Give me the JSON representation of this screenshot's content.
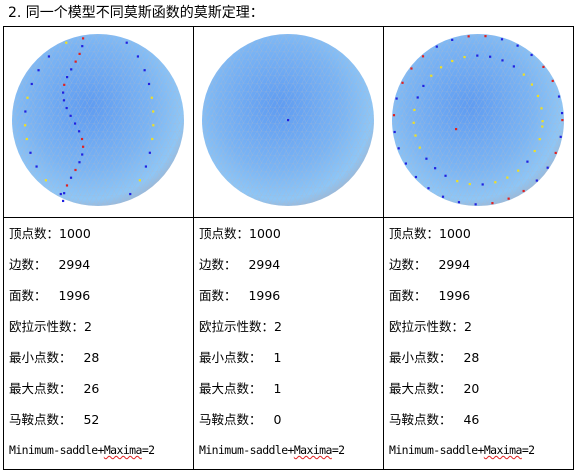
{
  "heading": "2. 同一个模型不同莫斯函数的莫斯定理：",
  "colors": {
    "sphere": "#6aa8f0",
    "min_point": "#2020e0",
    "max_point": "#e02020",
    "saddle_point": "#f0e020"
  },
  "columns": [
    {
      "vertices_label": "顶点数：",
      "vertices": "1000",
      "edges_label": "边数：",
      "edges": "2994",
      "faces_label": "面数：",
      "faces": "1996",
      "euler_label": "欧拉示性数：",
      "euler": "2",
      "min_label": "最小点数：",
      "min": "28",
      "max_label": "最大点数：",
      "max": "26",
      "saddle_label": "马鞍点数：",
      "saddle": "52",
      "formula_a": "Minimum-saddle+",
      "formula_b": "Maxima",
      "formula_c": "=2"
    },
    {
      "vertices_label": "顶点数：",
      "vertices": "1000",
      "edges_label": "边数：",
      "edges": "2994",
      "faces_label": "面数：",
      "faces": "1996",
      "euler_label": "欧拉示性数：",
      "euler": "2",
      "min_label": "最小点数：",
      "min": "1",
      "max_label": "最大点数：",
      "max": "1",
      "saddle_label": "马鞍点数：",
      "saddle": "0",
      "formula_a": "Minimum-saddle+",
      "formula_b": "Maxima",
      "formula_c": "=2"
    },
    {
      "vertices_label": "顶点数：",
      "vertices": "1000",
      "edges_label": "边数：",
      "edges": "2994",
      "faces_label": "面数：",
      "faces": "1996",
      "euler_label": "欧拉示性数：",
      "euler": "2",
      "min_label": "最小点数：",
      "min": "28",
      "max_label": "最大点数：",
      "max": "20",
      "saddle_label": "马鞍点数：",
      "saddle": "46",
      "formula_a": "Minimum-saddle+",
      "formula_b": "Maxima",
      "formula_c": "=2"
    }
  ]
}
